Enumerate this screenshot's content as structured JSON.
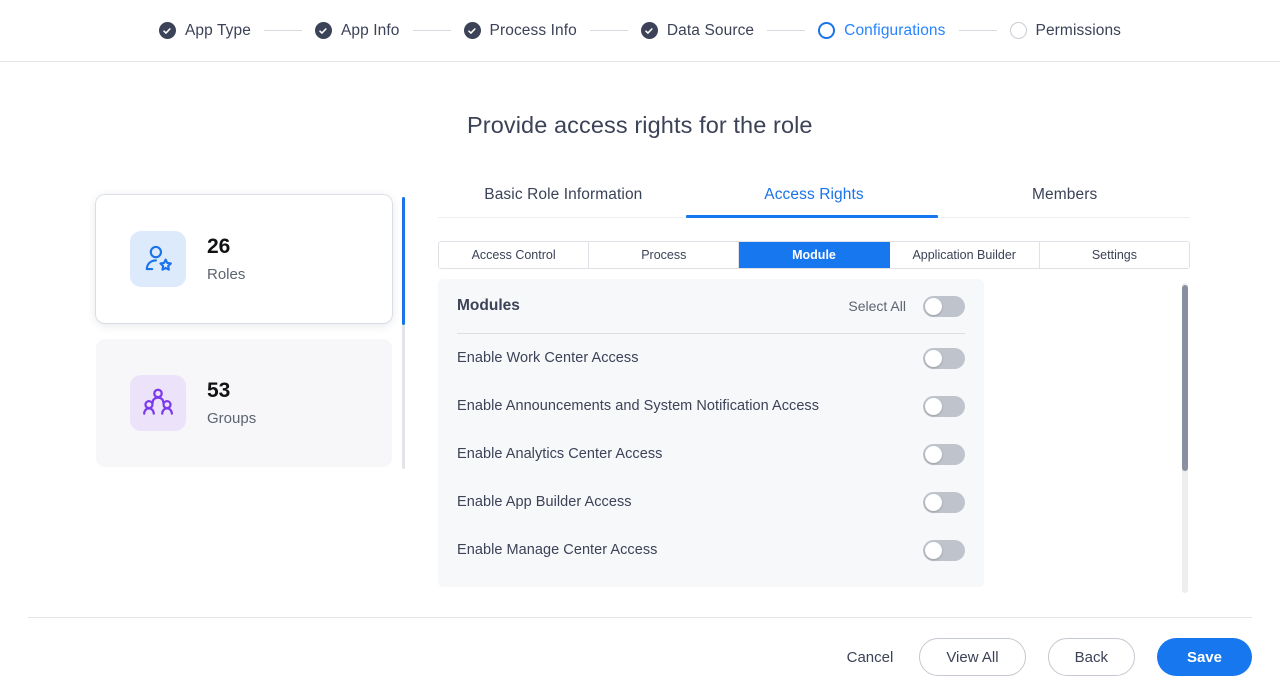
{
  "stepper": {
    "steps": [
      {
        "label": "App Type",
        "state": "done"
      },
      {
        "label": "App Info",
        "state": "done"
      },
      {
        "label": "Process Info",
        "state": "done"
      },
      {
        "label": "Data Source",
        "state": "done"
      },
      {
        "label": "Configurations",
        "state": "current"
      },
      {
        "label": "Permissions",
        "state": "pending"
      }
    ]
  },
  "page": {
    "title": "Provide access rights for the role"
  },
  "stats": {
    "cards": [
      {
        "count": "26",
        "caption": "Roles",
        "icon": "user-star-icon",
        "selected": true
      },
      {
        "count": "53",
        "caption": "Groups",
        "icon": "user-group-icon",
        "selected": false
      }
    ]
  },
  "tabs": {
    "items": [
      {
        "label": "Basic Role Information",
        "active": false
      },
      {
        "label": "Access Rights",
        "active": true
      },
      {
        "label": "Members",
        "active": false
      }
    ]
  },
  "subtabs": {
    "items": [
      {
        "label": "Access Control",
        "active": false
      },
      {
        "label": "Process",
        "active": false
      },
      {
        "label": "Module",
        "active": true
      },
      {
        "label": "Application Builder",
        "active": false
      },
      {
        "label": "Settings",
        "active": false
      }
    ]
  },
  "modules_panel": {
    "title": "Modules",
    "select_all_label": "Select All",
    "select_all_on": false,
    "rows": [
      {
        "label": "Enable Work Center Access",
        "on": false
      },
      {
        "label": "Enable Announcements and System Notification Access",
        "on": false
      },
      {
        "label": "Enable Analytics Center Access",
        "on": false
      },
      {
        "label": "Enable App Builder Access",
        "on": false
      },
      {
        "label": "Enable Manage Center Access",
        "on": false
      }
    ]
  },
  "footer": {
    "cancel_label": "Cancel",
    "view_all_label": "View All",
    "back_label": "Back",
    "save_label": "Save"
  },
  "colors": {
    "accent": "#1677ef",
    "step_current": "#2684ff",
    "roles_icon": "#1a73e8",
    "groups_icon": "#7c3aed",
    "toggle_off": "#bfc4cc"
  }
}
